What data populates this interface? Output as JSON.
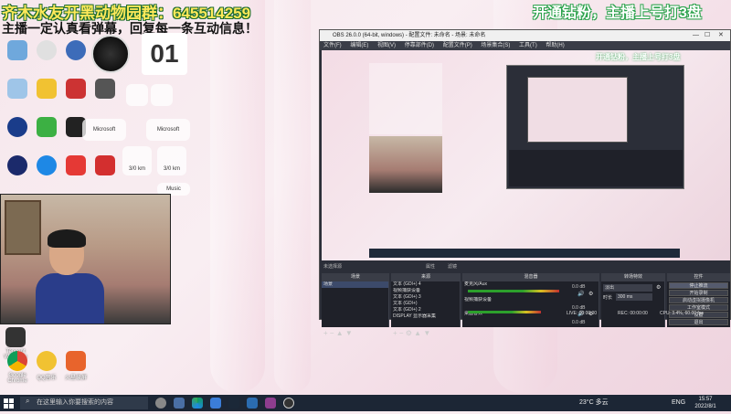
{
  "overlay": {
    "group_line": "齐木水友开黑动物园群：645514259",
    "notice_line": "主播一定认真看弹幕，回复每一条互动信息！",
    "right_line": "开通钻粉，主播上号打3盘"
  },
  "desktop": {
    "date_number": "01",
    "music_label": "Music",
    "microsoft_label_1": "Microsoft",
    "microsoft_label_2": "Microsoft",
    "tile_1": "3/0 km",
    "tile_2": "3/0 km",
    "bottom_icons": [
      "Google Chrome",
      "QQ音乐",
      "火星录屏"
    ],
    "middle_icon": "Tencent WeGame"
  },
  "obs": {
    "title": "OBS 26.0.0 (64-bit, windows) - 配置文件: 未命名 - 场景: 未命名",
    "menu": [
      "文件(F)",
      "编辑(E)",
      "视图(V)",
      "停靠部件(D)",
      "配置文件(P)",
      "场景集合(S)",
      "工具(T)",
      "帮助(H)"
    ],
    "preview_overlay_right": "开通钻粉，主播上号打3盘",
    "no_source_label": "未选择源",
    "properties_label": "属性",
    "filters_label": "滤镜",
    "docks": {
      "scenes": "场景",
      "sources": "来源",
      "mixer": "混音器",
      "transitions": "转场特效",
      "controls": "控件"
    },
    "scenes": [
      "场景"
    ],
    "sources": [
      "文本 (GDI+) 4",
      "视频捕获设备",
      "文本 (GDI+) 3",
      "文本 (GDI+)",
      "文本 (GDI+) 2",
      "DISPLAY 显示器采集"
    ],
    "mixer": [
      {
        "name": "麦克风/Aux",
        "db": "0.0 dB",
        "level": 0.72
      },
      {
        "name": "视频捕获设备",
        "db": "0.0 dB",
        "level": 0.55
      },
      {
        "name": "桌面音频",
        "db": "0.0 dB",
        "level": 0.0
      }
    ],
    "transition": {
      "type": "淡出",
      "duration_label": "时长",
      "duration": "300 ms"
    },
    "controls": [
      "停止推流",
      "开始录制",
      "启动虚拟摄像机",
      "工作室模式",
      "设置",
      "退出"
    ],
    "status": {
      "live": "LIVE: 00:00:00",
      "rec": "REC: 00:00:00",
      "cpu": "CPU: 3.4%, 60.00 fps"
    }
  },
  "taskbar": {
    "search_placeholder": "在这里输入你要搜索的内容",
    "weather": "23°C 多云",
    "lang": "ENG",
    "time": "15:57",
    "date": "2022/8/1"
  },
  "colors": {
    "overlay_yellow": "#ffe95a",
    "overlay_green_stroke": "#1a6b2d",
    "obs_bg": "#2b2e38",
    "taskbar_bg": "#1c2635"
  }
}
